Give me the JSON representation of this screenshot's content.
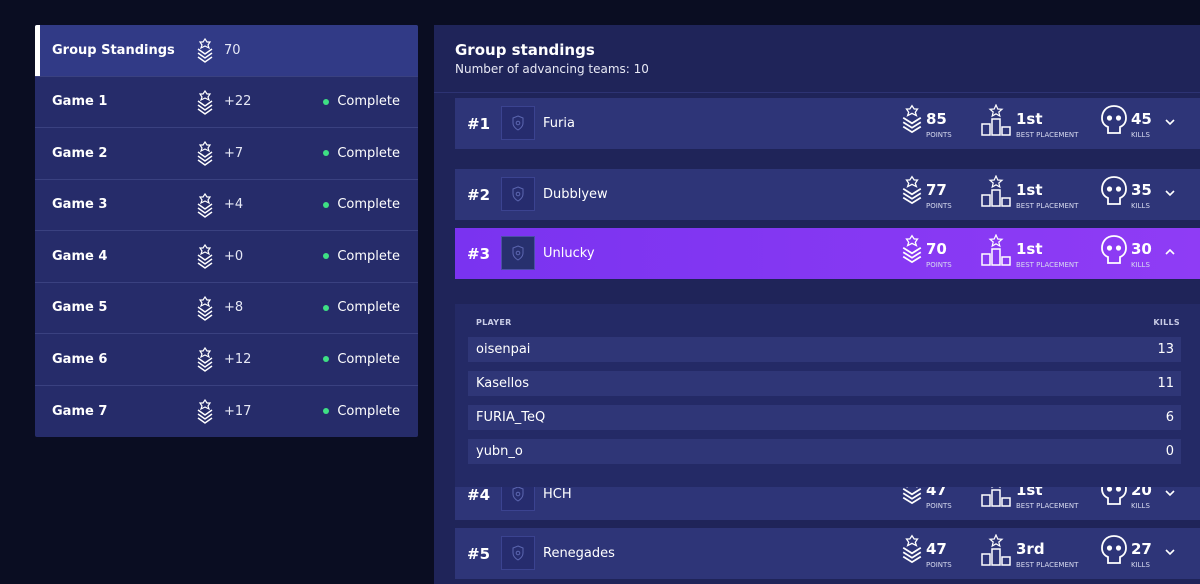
{
  "left_panel": {
    "items": [
      {
        "label": "Group Standings",
        "points": "70",
        "status": ""
      },
      {
        "label": "Game 1",
        "points": "+22",
        "status": "Complete"
      },
      {
        "label": "Game 2",
        "points": "+7",
        "status": "Complete"
      },
      {
        "label": "Game 3",
        "points": "+4",
        "status": "Complete"
      },
      {
        "label": "Game 4",
        "points": "+0",
        "status": "Complete"
      },
      {
        "label": "Game 5",
        "points": "+8",
        "status": "Complete"
      },
      {
        "label": "Game 6",
        "points": "+12",
        "status": "Complete"
      },
      {
        "label": "Game 7",
        "points": "+17",
        "status": "Complete"
      }
    ],
    "status_color": "#3ee084"
  },
  "standings": {
    "title": "Group standings",
    "subtitle": "Number of advancing teams: 10",
    "stat_labels": {
      "points": "POINTS",
      "placement": "BEST PLACEMENT",
      "kills": "KILLS"
    },
    "teams": [
      {
        "rank": "#1",
        "name": "Furia",
        "points": "85",
        "placement": "1st",
        "kills": "45"
      },
      {
        "rank": "#2",
        "name": "Dubblyew",
        "points": "77",
        "placement": "1st",
        "kills": "35"
      },
      {
        "rank": "#3",
        "name": "Unlucky",
        "points": "70",
        "placement": "1st",
        "kills": "30"
      },
      {
        "rank": "#4",
        "name": "HCH",
        "points": "47",
        "placement": "1st",
        "kills": "20"
      },
      {
        "rank": "#5",
        "name": "Renegades",
        "points": "47",
        "placement": "3rd",
        "kills": "27"
      }
    ],
    "expanded": {
      "header_player": "PLAYER",
      "header_kills": "KILLS",
      "players": [
        {
          "name": "oisenpai",
          "kills": "13"
        },
        {
          "name": "Kasellos",
          "kills": "11"
        },
        {
          "name": "FURIA_TeQ",
          "kills": "6"
        },
        {
          "name": "yubn_o",
          "kills": "0"
        }
      ]
    },
    "accent_color": "#8a3bf4"
  }
}
